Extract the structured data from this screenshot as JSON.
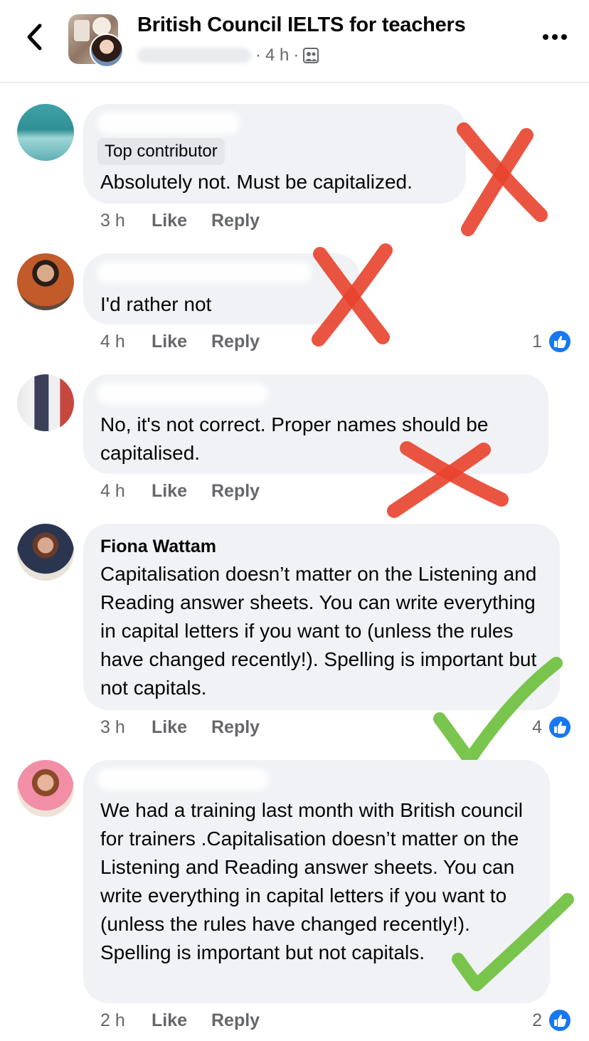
{
  "header": {
    "title": "British Council IELTS for teachers",
    "time": "4 h",
    "separator": "·"
  },
  "comments": [
    {
      "badge": "Top contributor",
      "text": "Absolutely not. Must be capitalized.",
      "time": "3 h",
      "like_label": "Like",
      "reply_label": "Reply",
      "annotation": "red-cross"
    },
    {
      "text": "I'd rather not",
      "time": "4 h",
      "like_label": "Like",
      "reply_label": "Reply",
      "reaction_count": "1",
      "annotation": "red-cross"
    },
    {
      "text": "No, it's not correct. Proper names should be capitalised.",
      "time": "4 h",
      "like_label": "Like",
      "reply_label": "Reply",
      "annotation": "red-cross"
    },
    {
      "author": "Fiona Wattam",
      "text": "Capitalisation doesn’t matter on the Listening and Reading answer sheets. You can write everything in capital letters if you want to (unless the rules have changed recently!). Spelling is important but not capitals.",
      "time": "3 h",
      "like_label": "Like",
      "reply_label": "Reply",
      "reaction_count": "4",
      "annotation": "green-check"
    },
    {
      "text": "We had a training last month with British council for trainers .Capitalisation doesn’t matter on the Listening and Reading answer sheets. You can write everything in capital letters if you want to (unless the rules have changed recently!). Spelling is important but not capitals.",
      "time": "2 h",
      "like_label": "Like",
      "reply_label": "Reply",
      "reaction_count": "2",
      "annotation": "green-check"
    }
  ],
  "colors": {
    "bubble": "#f0f2f5",
    "meta": "#65676b",
    "like_blue": "#1877f2",
    "cross_red": "#e8432e",
    "check_green": "#6cbf3a"
  },
  "icons": [
    "back-arrow-icon",
    "group-privacy-icon",
    "more-options-icon",
    "like-reaction-icon"
  ]
}
